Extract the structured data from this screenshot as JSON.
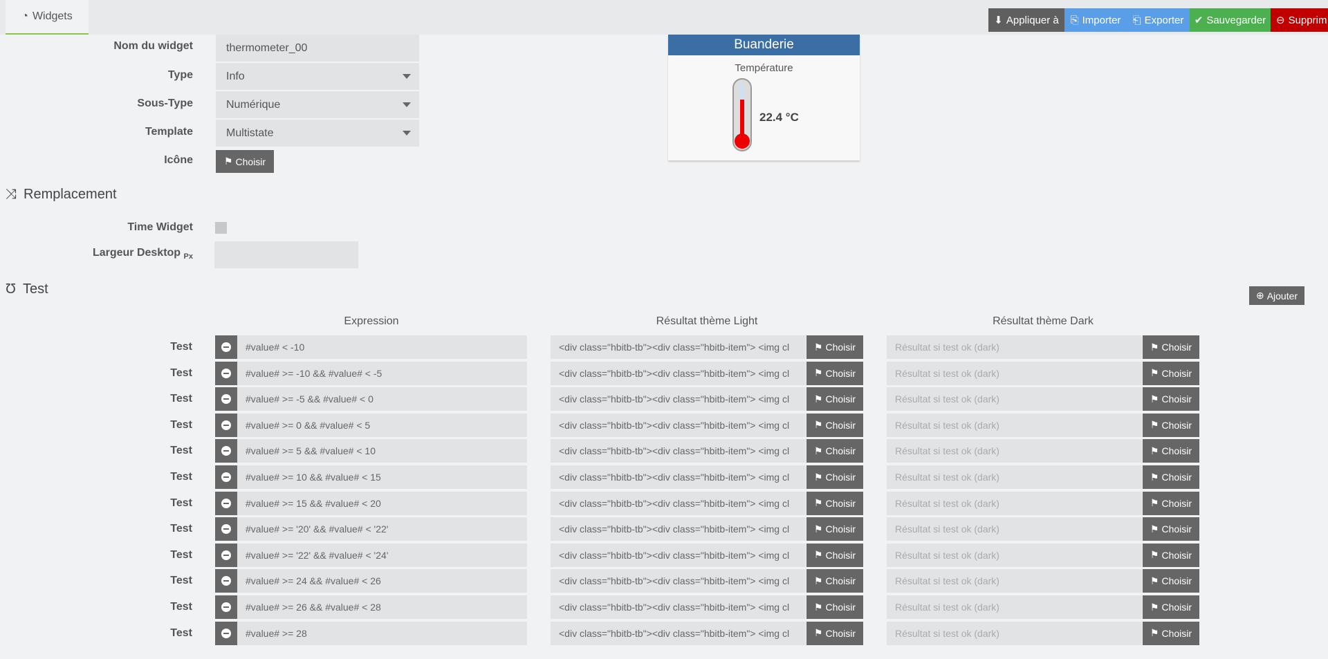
{
  "tab": {
    "label": "Widgets",
    "icon": "dashboard-icon"
  },
  "toolbar": {
    "apply": "Appliquer à",
    "import": "Importer",
    "export": "Exporter",
    "save": "Sauvegarder",
    "delete": "Supprim",
    "colors": {
      "apply": "#5f5f5f",
      "import": "#5b9ee8",
      "save": "#4caf50",
      "delete": "#c00000"
    }
  },
  "form": {
    "name_label": "Nom du widget",
    "name_value": "thermometer_00",
    "type_label": "Type",
    "type_value": "Info",
    "subtype_label": "Sous-Type",
    "subtype_value": "Numérique",
    "template_label": "Template",
    "template_value": "Multistate",
    "icon_label": "Icône",
    "choose": "Choisir"
  },
  "preview": {
    "title": "Buanderie",
    "name": "Température",
    "value": "22.4 °C"
  },
  "replacement": {
    "heading": "Remplacement",
    "time_widget": "Time Widget",
    "time_widget_checked": false,
    "width_label": "Largeur Desktop",
    "width_unit": "Px",
    "width_value": ""
  },
  "test": {
    "heading": "Test",
    "add": "Ajouter",
    "col_expression": "Expression",
    "col_light": "Résultat thème Light",
    "col_dark": "Résultat thème Dark",
    "row_label": "Test",
    "dark_placeholder": "Résultat si test ok (dark)",
    "choose": "Choisir",
    "rows": [
      {
        "expr": "#value# < -10",
        "light": "<div class=\"hbitb-tb\"><div class=\"hbitb-item\"> <img cl"
      },
      {
        "expr": "#value# >= -10 && #value# < -5",
        "light": "<div class=\"hbitb-tb\"><div class=\"hbitb-item\"> <img cl"
      },
      {
        "expr": "#value# >= -5 && #value# < 0",
        "light": "<div class=\"hbitb-tb\"><div class=\"hbitb-item\"> <img cl"
      },
      {
        "expr": "#value# >= 0 && #value# < 5",
        "light": "<div class=\"hbitb-tb\"><div class=\"hbitb-item\"> <img cl"
      },
      {
        "expr": "#value# >= 5 && #value# < 10",
        "light": "<div class=\"hbitb-tb\"><div class=\"hbitb-item\"> <img cl"
      },
      {
        "expr": "#value# >= 10 && #value# < 15",
        "light": "<div class=\"hbitb-tb\"><div class=\"hbitb-item\"> <img cl"
      },
      {
        "expr": "#value# >= 15 && #value# < 20",
        "light": "<div class=\"hbitb-tb\"><div class=\"hbitb-item\"> <img cl"
      },
      {
        "expr": "#value# >= '20' && #value# < '22'",
        "light": "<div class=\"hbitb-tb\"><div class=\"hbitb-item\"> <img cl"
      },
      {
        "expr": "#value# >= '22' && #value# < '24'",
        "light": "<div class=\"hbitb-tb\"><div class=\"hbitb-item\"> <img cl"
      },
      {
        "expr": "#value# >= 24 && #value# < 26",
        "light": "<div class=\"hbitb-tb\"><div class=\"hbitb-item\"> <img cl"
      },
      {
        "expr": "#value# >= 26 && #value# < 28",
        "light": "<div class=\"hbitb-tb\"><div class=\"hbitb-item\"> <img cl"
      },
      {
        "expr": "#value# >= 28",
        "light": "<div class=\"hbitb-tb\"><div class=\"hbitb-item\"> <img cl"
      }
    ]
  }
}
